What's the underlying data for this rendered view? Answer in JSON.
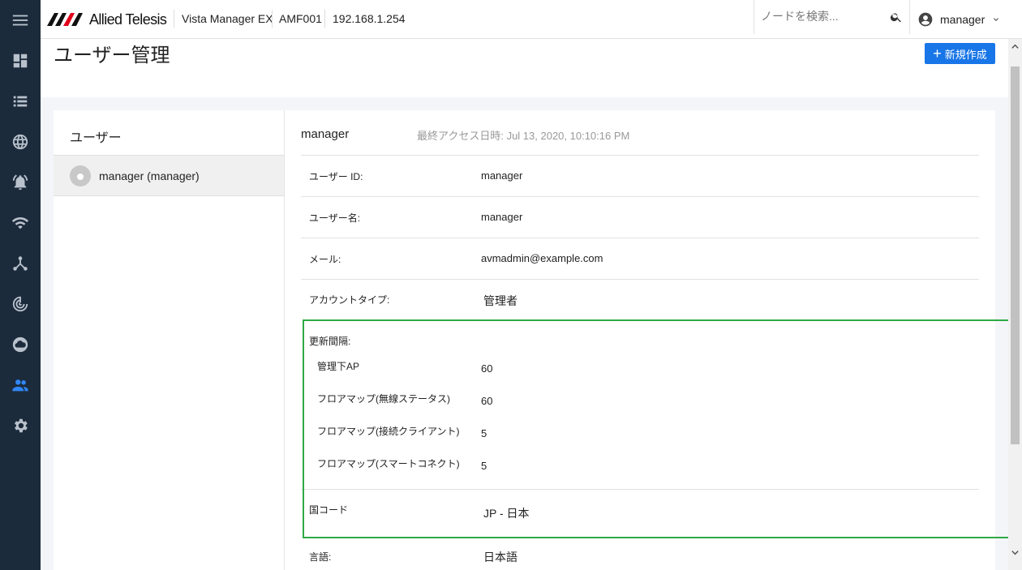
{
  "topbar": {
    "logo_text": "Allied Telesis",
    "product": "Vista Manager EX",
    "node": "AMF001",
    "ip": "192.168.1.254",
    "search_placeholder": "ノードを検索...",
    "user": "manager"
  },
  "nav": {
    "items": [
      "menu-icon",
      "dashboard-icon",
      "list-icon",
      "globe-icon",
      "alarm-icon",
      "wifi-icon",
      "topology-icon",
      "radar-icon",
      "cloud-icon",
      "users-icon",
      "gear-icon"
    ],
    "active": "users-icon",
    "active_color": "#2f86f6",
    "bg_color": "#1c2b3c"
  },
  "page": {
    "title": "ユーザー管理",
    "new_button": "新規作成",
    "new_button_color": "#1976e8"
  },
  "user_list": {
    "header": "ユーザー",
    "items": [
      {
        "label": "manager (manager)"
      }
    ]
  },
  "detail": {
    "name": "manager",
    "last_access": "最終アクセス日時: Jul 13, 2020, 10:10:16 PM",
    "fields": {
      "user_id_label": "ユーザー ID:",
      "user_id": "manager",
      "username_label": "ユーザー名:",
      "username": "manager",
      "email_label": "メール:",
      "email": "avmadmin@example.com",
      "account_type_label": "アカウントタイプ:",
      "account_type": "管理者",
      "update_interval_label": "更新間隔:",
      "intervals": [
        {
          "label": "管理下AP",
          "value": "60"
        },
        {
          "label": "フロアマップ(無線ステータス)",
          "value": "60"
        },
        {
          "label": "フロアマップ(接続クライアント)",
          "value": "5"
        },
        {
          "label": "フロアマップ(スマートコネクト)",
          "value": "5"
        }
      ],
      "country_label": "国コード",
      "country": "JP - 日本",
      "language_label": "言語:",
      "language": "日本語"
    },
    "highlight_color": "#2eaa45"
  }
}
